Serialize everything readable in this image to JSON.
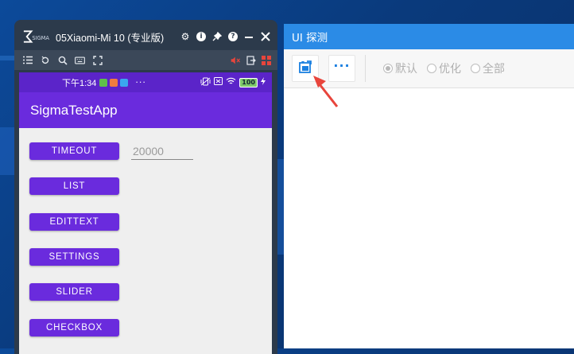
{
  "phone_window": {
    "title": "05Xiaomi-Mi 10 (专业版)",
    "logo_text": "SIGMA",
    "title_icons": [
      "gear-icon",
      "info-icon",
      "pin-icon",
      "help-icon",
      "minimize-icon",
      "close-icon"
    ],
    "toolbar_icons": [
      "list-icon",
      "rotate-icon",
      "zoom-icon",
      "keyboard-icon",
      "fullscreen-icon"
    ],
    "toolbar_right_icons": [
      "mute-icon",
      "export-icon",
      "grid-icon"
    ]
  },
  "phone": {
    "status_time": "下午1:34",
    "status_dots": "···",
    "battery": "100",
    "app_title": "SigmaTestApp",
    "buttons": [
      {
        "label": "TIMEOUT"
      },
      {
        "label": "LIST"
      },
      {
        "label": "EDITTEXT"
      },
      {
        "label": "SETTINGS"
      },
      {
        "label": "SLIDER"
      },
      {
        "label": "CHECKBOX"
      }
    ],
    "timeout_value": "20000"
  },
  "probe_window": {
    "title": "UI 探测",
    "more_label": "···",
    "radios": [
      {
        "label": "默认",
        "selected": true
      },
      {
        "label": "优化",
        "selected": false
      },
      {
        "label": "全部",
        "selected": false
      }
    ]
  },
  "colors": {
    "accent_blue": "#2b8be6",
    "app_purple": "#6a2bdd",
    "status_purple": "#5b24c9",
    "arrow_red": "#e8453c"
  }
}
